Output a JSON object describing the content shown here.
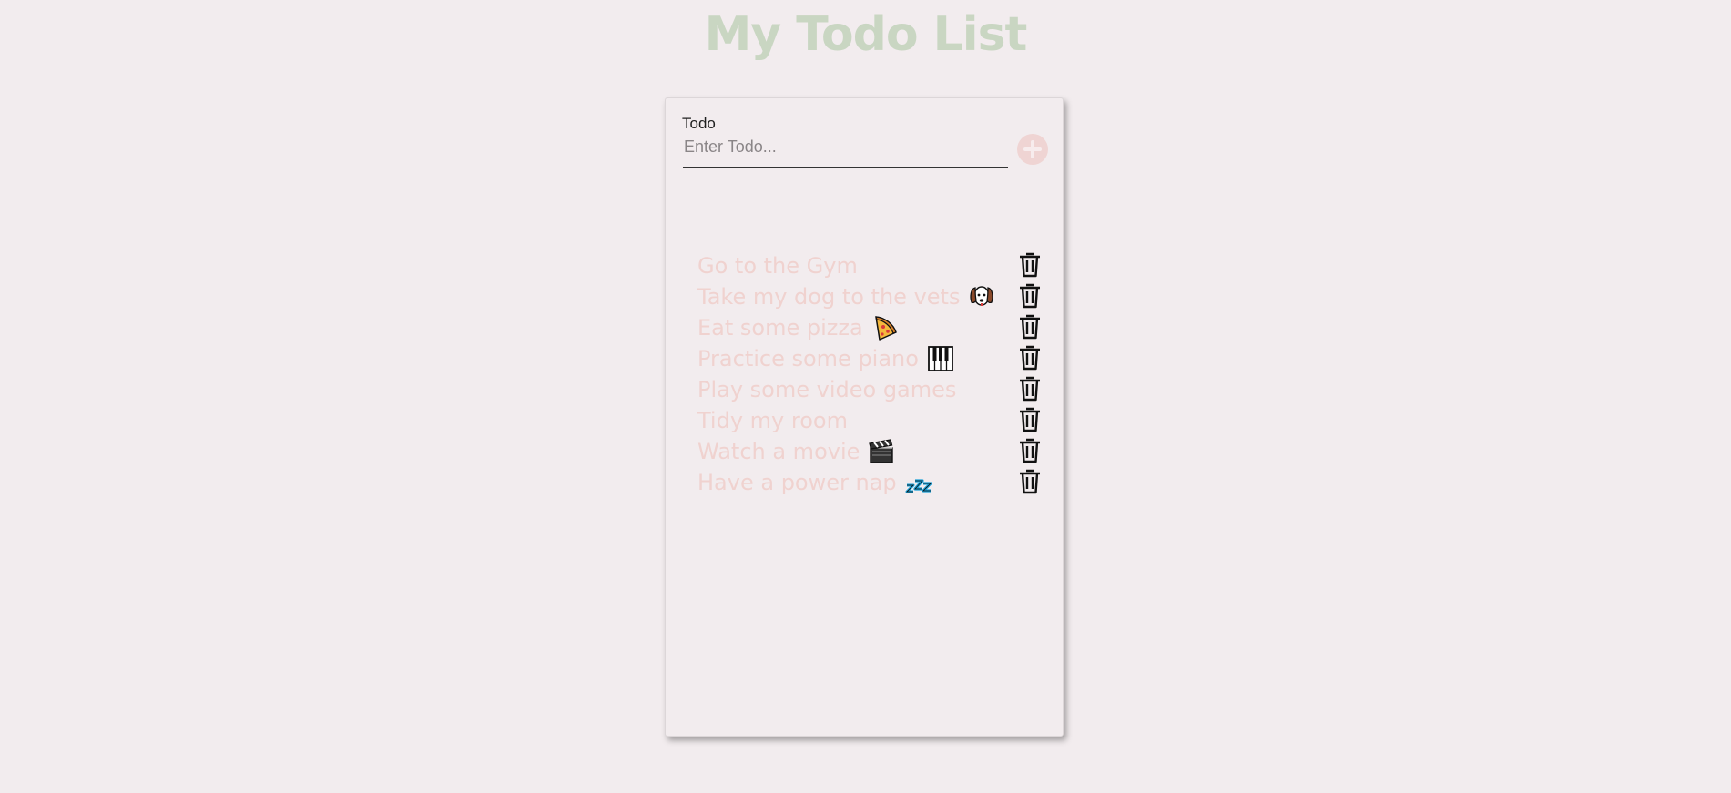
{
  "header": {
    "title": "My Todo List"
  },
  "form": {
    "label": "Todo",
    "placeholder": "Enter Todo...",
    "value": "",
    "add_icon": "plus-circle-icon"
  },
  "todos": [
    {
      "text": "Go to the Gym",
      "emoji": ""
    },
    {
      "text": "Take my dog to the vets",
      "emoji": "dog-face-icon"
    },
    {
      "text": "Eat some pizza",
      "emoji": "pizza-icon"
    },
    {
      "text": "Practice some piano",
      "emoji": "piano-keys-icon"
    },
    {
      "text": "Play some video games",
      "emoji": ""
    },
    {
      "text": "Tidy my room",
      "emoji": ""
    },
    {
      "text": "Watch a movie",
      "emoji": "clapper-board-icon"
    },
    {
      "text": "Have a power nap",
      "emoji": "zzz-icon"
    }
  ],
  "delete_icon": "trash-icon",
  "colors": {
    "background": "#f2ecee",
    "title": "#c9d6c2",
    "todo_text": "#f0d2cf",
    "add_button": "#efd4d3"
  }
}
